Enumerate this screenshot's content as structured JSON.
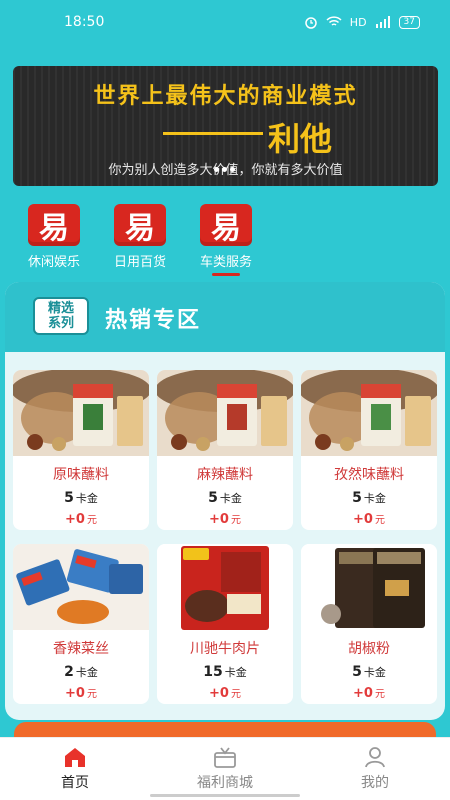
{
  "status_bar": {
    "time": "18:50",
    "network": "HD",
    "battery": "37"
  },
  "banner": {
    "title": "世界上最伟大的商业模式",
    "slogan": "利他",
    "subtitle": "你为别人创造多大价值，你就有多大价值"
  },
  "categories": [
    {
      "icon_text": "易",
      "label": "休闲娱乐"
    },
    {
      "icon_text": "易",
      "label": "日用百货"
    },
    {
      "icon_text": "易",
      "label": "车类服务"
    }
  ],
  "hot_section": {
    "badge": "精选\n系列",
    "title": "热销专区",
    "products": [
      {
        "name": "原味蘸料",
        "price": "5",
        "price_unit": "卡金",
        "extra": "+0",
        "extra_unit": "元"
      },
      {
        "name": "麻辣蘸料",
        "price": "5",
        "price_unit": "卡金",
        "extra": "+0",
        "extra_unit": "元"
      },
      {
        "name": "孜然味蘸料",
        "price": "5",
        "price_unit": "卡金",
        "extra": "+0",
        "extra_unit": "元"
      },
      {
        "name": "香辣菜丝",
        "price": "2",
        "price_unit": "卡金",
        "extra": "+0",
        "extra_unit": "元"
      },
      {
        "name": "川驰牛肉片",
        "price": "15",
        "price_unit": "卡金",
        "extra": "+0",
        "extra_unit": "元"
      },
      {
        "name": "胡椒粉",
        "price": "5",
        "price_unit": "卡金",
        "extra": "+0",
        "extra_unit": "元"
      }
    ]
  },
  "tabbar": {
    "items": [
      {
        "label": "首页",
        "icon": "home-icon",
        "active": true
      },
      {
        "label": "福利商城",
        "icon": "gift-box-icon",
        "active": false
      },
      {
        "label": "我的",
        "icon": "person-icon",
        "active": false
      }
    ]
  },
  "colors": {
    "background": "#2ec8d2",
    "accent_red": "#d8271f",
    "banner_gold": "#f5c21a"
  }
}
